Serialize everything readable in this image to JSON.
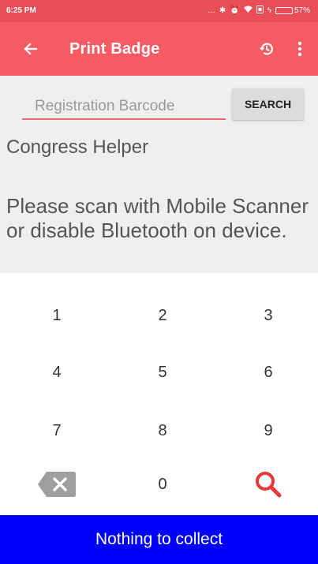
{
  "status_bar": {
    "time": "6:25 PM",
    "battery_text": "57%",
    "icons": [
      "ellipsis-icon",
      "bluetooth-icon",
      "alarm-icon",
      "wifi-icon",
      "sim-icon",
      "charging-icon",
      "battery-icon"
    ],
    "battery_level": 0.57
  },
  "app_bar": {
    "title": "Print Badge",
    "icons": {
      "back": "arrow-left-icon",
      "history": "history-icon",
      "menu": "more-vertical-icon"
    }
  },
  "search": {
    "placeholder": "Registration Barcode",
    "value": "",
    "button_label": "SEARCH"
  },
  "content": {
    "app_name": "Congress Helper",
    "message": "Please scan with Mobile Scanner or disable Bluetooth on device."
  },
  "keypad": {
    "keys": [
      "1",
      "2",
      "3",
      "4",
      "5",
      "6",
      "7",
      "8",
      "9",
      "0"
    ],
    "icons": {
      "delete": "backspace-icon",
      "search": "search-icon"
    }
  },
  "footer": {
    "label": "Nothing to collect"
  },
  "colors": {
    "status_bar": "#e94d57",
    "app_bar": "#f65b63",
    "content_bg": "#efefef",
    "input_underline": "#f06872",
    "search_key": "#e53935",
    "delete_key": "#9e9e9e",
    "footer": "#0000ff"
  }
}
